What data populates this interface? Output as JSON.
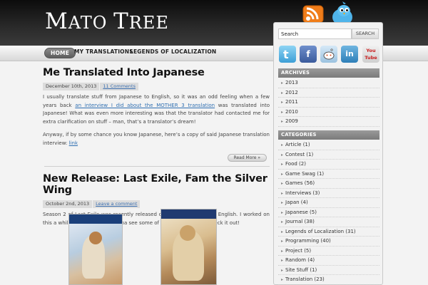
{
  "site": {
    "title_first": "M",
    "title_rest_1": "ATO ",
    "title_t": "T",
    "title_rest_2": "REE"
  },
  "header_icons": [
    "rss-icon",
    "twitter-bird-icon"
  ],
  "nav": {
    "items": [
      "HOME",
      "MY TRANSLATIONS",
      "LEGENDS OF LOCALIZATION"
    ]
  },
  "posts": [
    {
      "title": "Me Translated Into Japanese",
      "date": "December 10th, 2013",
      "comments": "11 Comments",
      "p1_before": "I usually translate stuff from Japanese to English, so it was an odd feeling when a few years back ",
      "p1_link": "an interview I did about the MOTHER 3 translation",
      "p1_after": " was translated into Japanese! What was even more interesting was that the translator had contacted me for extra clarification on stuff – man, that’s a translator’s dream!",
      "p2_before": "Anyway, if by some chance you know Japanese, here’s a copy of said Japanese translation interview: ",
      "p2_link": "link",
      "read_more": "Read More »"
    },
    {
      "title": "New Release: Last Exile, Fam the Silver Wing",
      "date": "October 2nd, 2013",
      "comments": "Leave a comment",
      "p1": "Season 2 of Last Exile was recently released on DVD and Blu-ray in English. I worked on this a while back, so if you wanna see some of my work in action, check it out!"
    }
  ],
  "sidebar": {
    "search_placeholder": "Search",
    "search_value": "Search",
    "search_button": "SEARCH",
    "social": [
      "twitter-icon",
      "facebook-icon",
      "reddit-icon",
      "linkedin-icon",
      "youtube-icon"
    ],
    "social_labels": {
      "facebook": "f",
      "linkedin": "in",
      "youtube_you": "You",
      "youtube_tube": "Tube"
    },
    "archives_title": "ARCHIVES",
    "archives": [
      "2013",
      "2012",
      "2011",
      "2010",
      "2009"
    ],
    "categories_title": "CATEGORIES",
    "categories": [
      "Article (1)",
      "Contest (1)",
      "Food (2)",
      "Game Swag (1)",
      "Games (56)",
      "Interviews (3)",
      "Japan (4)",
      "Japanese (5)",
      "Journal (38)",
      "Legends of Localization (31)",
      "Programming (40)",
      "Project (5)",
      "Random (4)",
      "Site Stuff (1)",
      "Translation (23)"
    ]
  },
  "colors": {
    "header_bg": "#1a1a1a",
    "link": "#2f6fb2",
    "widget_title_bg": "#8a8a8a"
  }
}
